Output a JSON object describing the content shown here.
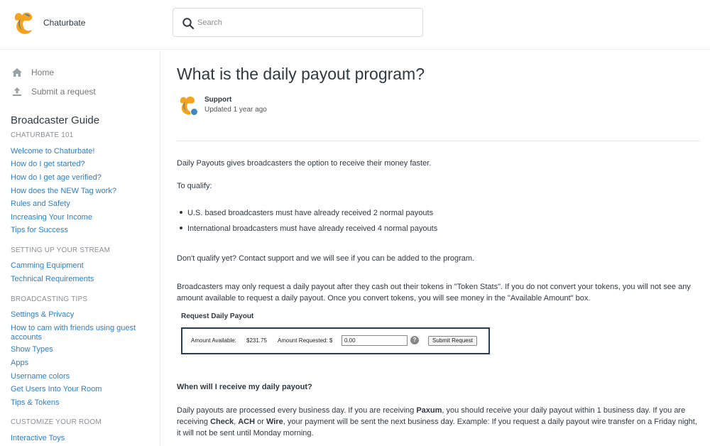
{
  "header": {
    "brand": "Chaturbate",
    "search_placeholder": "Search"
  },
  "sidebar": {
    "home": "Home",
    "submit": "Submit a request",
    "guide_title": "Broadcaster Guide",
    "sections": [
      {
        "title": "CHATURBATE 101",
        "links": [
          "Welcome to Chaturbate!",
          "How do I get started?",
          "How do I get age verified?",
          "How does the NEW Tag work?",
          "Rules and Safety",
          "Increasing Your Income",
          "Tips for Success"
        ]
      },
      {
        "title": "SETTING UP YOUR STREAM",
        "links": [
          "Camming Equipment",
          "Technical Requirements"
        ]
      },
      {
        "title": "BROADCASTING TIPS",
        "links": [
          "Settings & Privacy",
          "How to cam with friends using guest accounts",
          "Show Types",
          "Apps",
          "Username colors",
          "Get Users Into Your Room",
          "Tips & Tokens"
        ]
      },
      {
        "title": "CUSTOMIZE YOUR ROOM",
        "links": [
          "Interactive Toys"
        ]
      }
    ]
  },
  "article": {
    "title": "What is the daily payout program?",
    "author": "Support",
    "updated": "Updated 1 year ago",
    "p1": "Daily Payouts gives broadcasters the option to receive their money faster.",
    "p2": "To qualify:",
    "bullets": [
      "U.S. based broadcasters must have already received 2 normal payouts",
      "International broadcasters must have already received 4 normal payouts"
    ],
    "p3": "Don't qualify yet?  Contact support and we will see if you can be added to the program.",
    "p4": "Broadcasters may only request a daily payout after they cash out their tokens in \"Token Stats\".   If you do not convert your tokens, you will not see any amount available to request a daily payout.  Once you convert tokens, you will see money in the \"Available Amount\" box.",
    "request": {
      "title": "Request Daily Payout",
      "available_label": "Amount Available:",
      "available_value": "$231.75",
      "requested_label": "Amount Requested: $",
      "requested_value": "0.00",
      "help": "?",
      "submit": "Submit Request"
    },
    "subhead": "When will I receive my daily payout?",
    "p5": {
      "a": "Daily payouts are processed every business day. If you are receiving ",
      "paxum": "Paxum",
      "b": ", you should receive your daily payout within 1 business day.  If you are receiving ",
      "check": "Check",
      "c": ", ",
      "ach": "ACH",
      "d": " or ",
      "wire": "Wire",
      "e": ", your payment will be sent the next business day.  Example:  If you request a daily payout wire transfer on a Friday night, it will not be sent until Monday morning."
    }
  }
}
